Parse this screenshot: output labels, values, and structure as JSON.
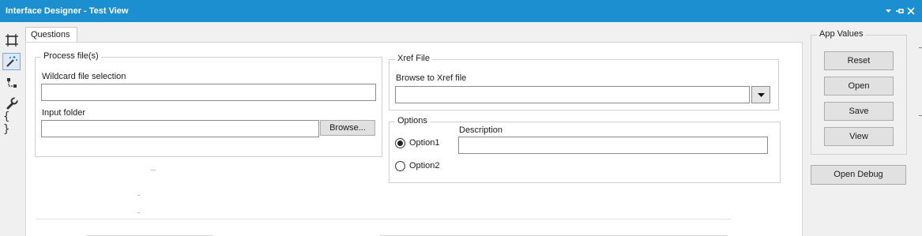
{
  "window": {
    "title": "Interface Designer - Test View",
    "controls": {
      "dropdown_icon": "dropdown-arrow-icon",
      "pin_icon": "pin-icon",
      "close_icon": "close-icon"
    }
  },
  "toolbar": {
    "items": [
      {
        "icon": "layout-icon"
      },
      {
        "icon": "magic-wand-icon",
        "active": true
      },
      {
        "icon": "tree-connector-icon"
      },
      {
        "icon": "wrench-icon"
      },
      {
        "icon": "braces-icon",
        "glyph": "{ }"
      }
    ]
  },
  "tabs": [
    {
      "label": "Questions",
      "active": true
    }
  ],
  "process_files": {
    "legend": "Process file(s)",
    "wildcard": {
      "label": "Wildcard file selection",
      "value": ""
    },
    "input_folder": {
      "label": "Input folder",
      "value": "",
      "browse_label": "Browse..."
    }
  },
  "xref_file": {
    "legend": "Xref File",
    "browse_label": "Browse to Xref file",
    "value": ""
  },
  "options": {
    "legend": "Options",
    "radios": [
      {
        "label": "Option1",
        "checked": true
      },
      {
        "label": "Option2",
        "checked": false
      }
    ],
    "description": {
      "label": "Description",
      "value": ""
    }
  },
  "app_values": {
    "legend": "App Values",
    "buttons": [
      "Reset",
      "Open",
      "Save",
      "View"
    ]
  },
  "open_debug": {
    "label": "Open Debug"
  }
}
